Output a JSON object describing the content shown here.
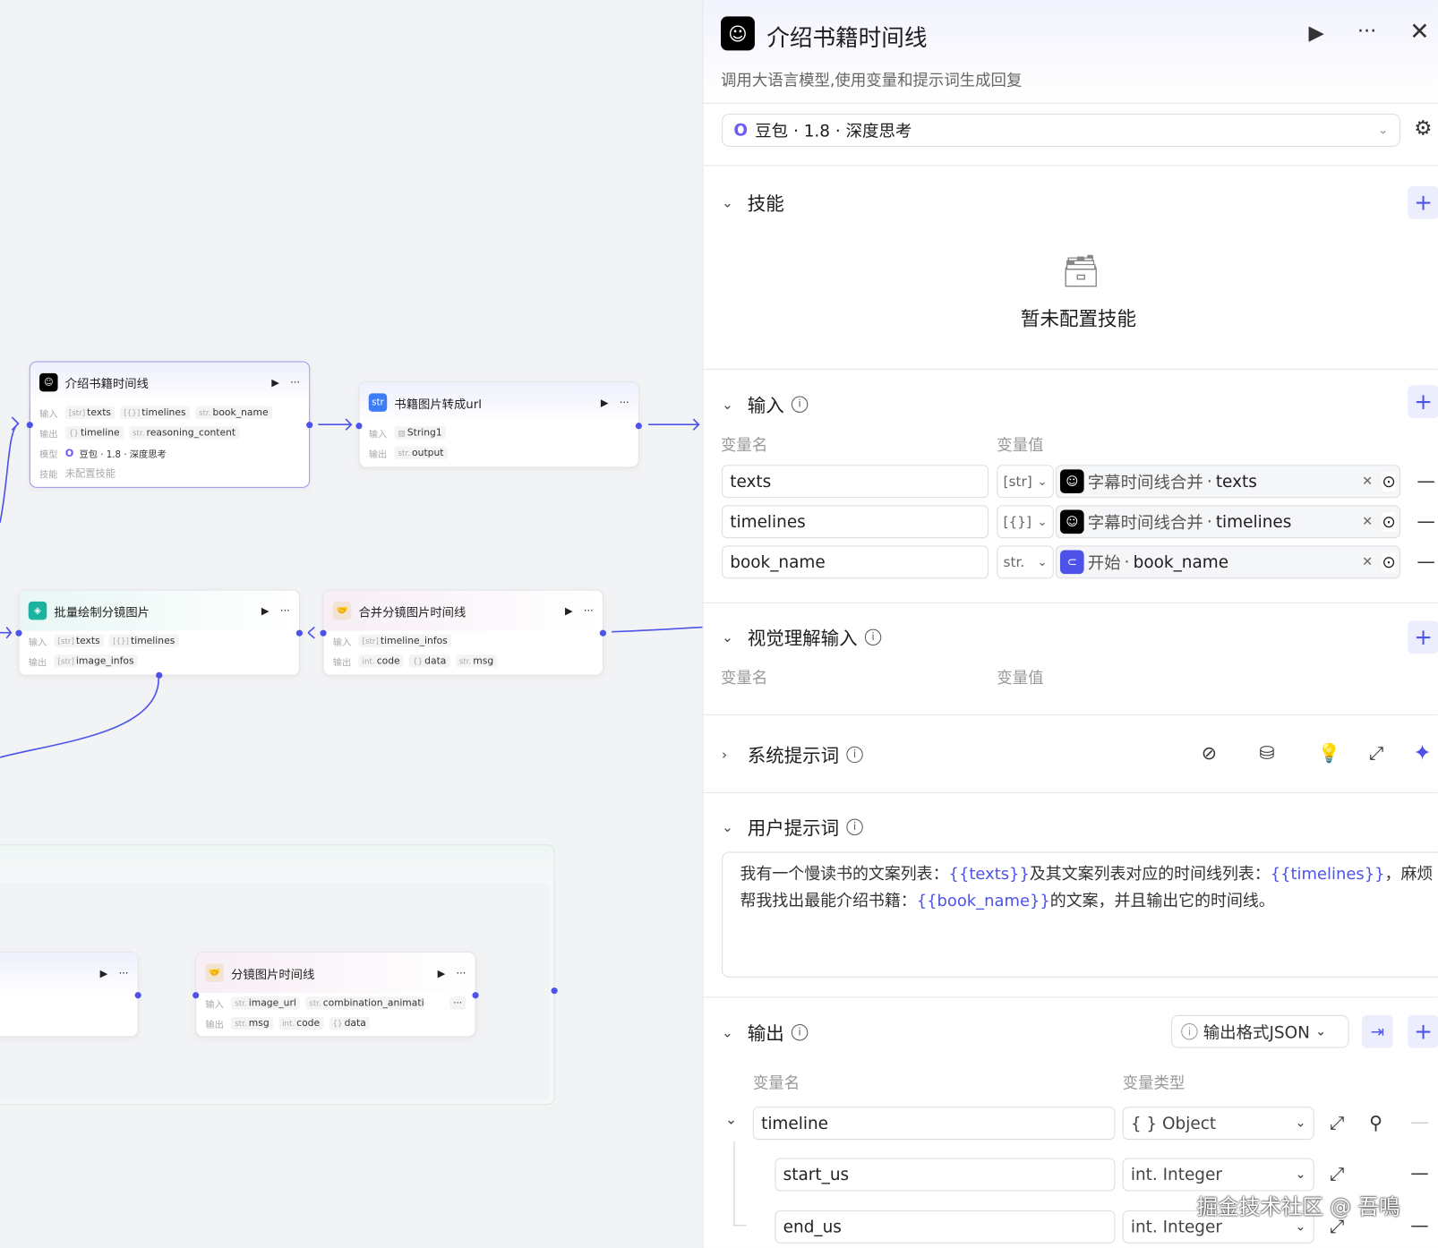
{
  "canvas": {
    "node1": {
      "title": "介绍书籍时间线",
      "in_label": "输入",
      "out_label": "输出",
      "model_label": "模型",
      "skill_label": "技能",
      "inputs": [
        {
          "type": "[str]",
          "name": "texts"
        },
        {
          "type": "[{}]",
          "name": "timelines"
        },
        {
          "type": "str.",
          "name": "book_name"
        }
      ],
      "outputs": [
        {
          "type": "{}",
          "name": "timeline"
        },
        {
          "type": "str.",
          "name": "reasoning_content"
        }
      ],
      "model": "豆包 · 1.8 · 深度思考",
      "skill": "未配置技能"
    },
    "node2": {
      "title": "书籍图片转成url",
      "in_label": "输入",
      "out_label": "输出",
      "inputs": [
        {
          "type": "img",
          "name": "String1"
        }
      ],
      "outputs": [
        {
          "type": "str.",
          "name": "output"
        }
      ]
    },
    "node3": {
      "title": "批量绘制分镜图片",
      "in_label": "输入",
      "out_label": "输出",
      "inputs": [
        {
          "type": "[str]",
          "name": "texts"
        },
        {
          "type": "[{}]",
          "name": "timelines"
        }
      ],
      "outputs": [
        {
          "type": "[str]",
          "name": "image_infos"
        }
      ]
    },
    "node4": {
      "title": "合并分镜图片时间线",
      "in_label": "输入",
      "out_label": "输出",
      "inputs": [
        {
          "type": "[str]",
          "name": "timeline_infos"
        }
      ],
      "outputs": [
        {
          "type": "int.",
          "name": "code"
        },
        {
          "type": "{}",
          "name": "data"
        },
        {
          "type": "str.",
          "name": "msg"
        }
      ]
    },
    "node6": {
      "title": "分镜图片时间线",
      "in_label": "输入",
      "out_label": "输出",
      "inputs": [
        {
          "type": "str.",
          "name": "image_url"
        },
        {
          "type": "str.",
          "name": "combination_animation"
        }
      ],
      "outputs": [
        {
          "type": "str.",
          "name": "msg"
        },
        {
          "type": "int.",
          "name": "code"
        },
        {
          "type": "{}",
          "name": "data"
        }
      ],
      "more": "···"
    }
  },
  "panel": {
    "title": "介绍书籍时间线",
    "subtitle": "调用大语言模型,使用变量和提示词生成回复",
    "model": "豆包 · 1.8 · 深度思考",
    "skills": {
      "title": "技能",
      "empty": "暂未配置技能"
    },
    "inputs": {
      "title": "输入",
      "col_name": "变量名",
      "col_value": "变量值",
      "rows": [
        {
          "name": "texts",
          "type": "[str]",
          "src_node": "字幕时间线合并",
          "src_var": "texts"
        },
        {
          "name": "timelines",
          "type": "[{}]",
          "src_node": "字幕时间线合并",
          "src_var": "timelines"
        },
        {
          "name": "book_name",
          "type": "str.",
          "src_node": "开始",
          "src_var": "book_name"
        }
      ]
    },
    "vision": {
      "title": "视觉理解输入",
      "col_name": "变量名",
      "col_value": "变量值"
    },
    "system_prompt": {
      "title": "系统提示词"
    },
    "user_prompt": {
      "title": "用户提示词",
      "p1": "我有一个慢读书的文案列表：",
      "v1": "{{texts}}",
      "p2": "及其文案列表对应的时间线列表：",
      "v2": "{{timelines}}",
      "p3": "，麻烦帮我找出最能介绍书籍：",
      "v3": "{{book_name}}",
      "p4": "的文案，并且输出它的时间线。"
    },
    "output": {
      "title": "输出",
      "format": "输出格式JSON",
      "col_name": "变量名",
      "col_type": "变量类型",
      "rows": [
        {
          "name": "timeline",
          "type": "{ } Object"
        },
        {
          "name": "start_us",
          "type": "int. Integer"
        },
        {
          "name": "end_us",
          "type": "int. Integer"
        }
      ]
    }
  },
  "watermark": "掘金技术社区 @ 吾鳴"
}
